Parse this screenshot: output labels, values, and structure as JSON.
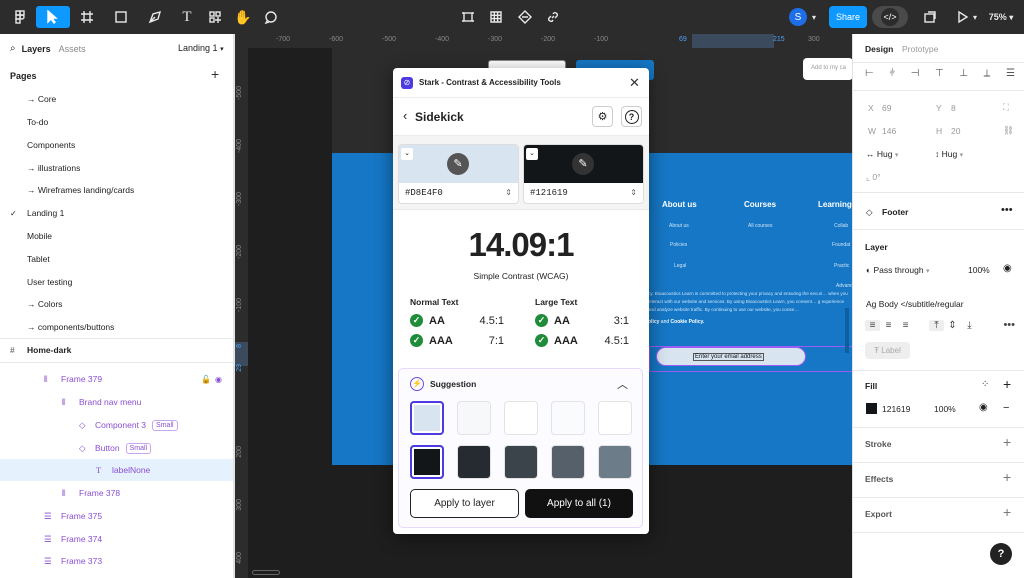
{
  "toolbar": {
    "share": "Share",
    "avatar": "S",
    "zoom": "75%"
  },
  "left": {
    "tabs": [
      "Layers",
      "Assets"
    ],
    "page_select": "Landing 1",
    "pages_title": "Pages",
    "pages": [
      "→ Core",
      "To-do",
      "Components",
      "→ illustrations",
      "→ Wireframes landing/cards",
      "Landing 1",
      "Mobile",
      "Tablet",
      "User testing",
      "→ Colors",
      "→ components/buttons"
    ],
    "current_page": "Home-dark",
    "layers": [
      {
        "label": "Frame 379"
      },
      {
        "label": "Brand nav menu"
      },
      {
        "label": "Component 3",
        "chip": "Small"
      },
      {
        "label": "Button",
        "chip": "Small"
      },
      {
        "label": "labelNone"
      },
      {
        "label": "Frame 378"
      },
      {
        "label": "Frame 375"
      },
      {
        "label": "Frame 374"
      },
      {
        "label": "Frame 373"
      }
    ]
  },
  "ruler_top": [
    "-700",
    "-600",
    "-500",
    "-400",
    "-300",
    "-200",
    "-100",
    "69",
    "215",
    "300"
  ],
  "ruler_left": [
    "-500",
    "-400",
    "-300",
    "-200",
    "-100",
    "8",
    "29",
    "200",
    "300",
    "400"
  ],
  "canvas": {
    "footer_cols": [
      "About us",
      "Courses",
      "Learning"
    ],
    "footer_links": [
      [
        "About us",
        "Policies",
        "Legal"
      ],
      [
        "All courses"
      ],
      [
        "Collab",
        "Foundat",
        "Practic",
        "Advanc"
      ]
    ],
    "legal_text": "cy. Bioacoustics Learn is committed to protecting your privacy and ensuring the securi… when you interact with our website and services. By using Bioacoustics Learn, you consent… g experience and analyze website traffic. By continuing to use our website, you conse…",
    "legal_policy": "olicy",
    "legal_and": "and",
    "legal_cookie": "Cookie Policy.",
    "email_placeholder": "Enter your email address",
    "add_to_cart": "Add to my ca"
  },
  "stark": {
    "title": "Stark - Contrast & Accessibility Tools",
    "header": "Sidekick",
    "bg_hex": "#D8E4F0",
    "fg_hex": "#121619",
    "ratio": "14.09:1",
    "ratio_label": "Simple Contrast (WCAG)",
    "normal_text": "Normal Text",
    "large_text": "Large Text",
    "normal": [
      {
        "level": "AA",
        "value": "4.5:1"
      },
      {
        "level": "AAA",
        "value": "7:1"
      }
    ],
    "large": [
      {
        "level": "AA",
        "value": "3:1"
      },
      {
        "level": "AAA",
        "value": "4.5:1"
      }
    ],
    "suggestion": "Suggestion",
    "light_swatches": [
      "#D8E4F0",
      "#F6F8FA",
      "#FFFFFF",
      "#FAFBFC",
      "#FFFFFF"
    ],
    "dark_swatches": [
      "#121619",
      "#252B31",
      "#3B434B",
      "#55606B",
      "#6D7C89"
    ],
    "apply_layer": "Apply to layer",
    "apply_all": "Apply to all (1)"
  },
  "right": {
    "tabs": [
      "Design",
      "Prototype"
    ],
    "x_label": "X",
    "x": "69",
    "y_label": "Y",
    "y": "8",
    "w_label": "W",
    "w": "146",
    "h_label": "H",
    "h": "20",
    "hug1": "Hug",
    "hug2": "Hug",
    "rotation": "0°",
    "component": "Footer",
    "layer_title": "Layer",
    "blend": "Pass through",
    "opacity": "100%",
    "text_style": "Body </subtitle/regular",
    "label_btn": "Label",
    "fill_title": "Fill",
    "fill_hex": "121619",
    "fill_opacity": "100%",
    "stroke": "Stroke",
    "effects": "Effects",
    "export": "Export",
    "help": "?"
  }
}
